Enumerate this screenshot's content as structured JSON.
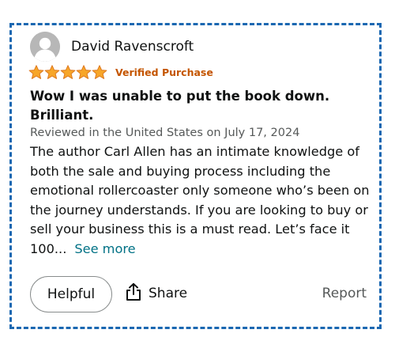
{
  "reviewer": {
    "name": "David Ravenscroft",
    "avatar_icon": "user-silhouette-icon"
  },
  "rating": {
    "stars": 5,
    "max_stars": 5,
    "star_color": "#f7a629",
    "verified_label": "Verified Purchase"
  },
  "review": {
    "title": "Wow I was unable to put the book down. Brilliant.",
    "date_line": "Reviewed in the United States on July 17, 2024",
    "body": "The author Carl Allen has an intimate knowledge of both the sale and buying process including the emotional rollercoaster only someone who’s been on the journey understands. If you are looking to buy or sell your business this is a must read. Let’s face it 100...",
    "see_more_label": "See more"
  },
  "actions": {
    "helpful_label": "Helpful",
    "share_label": "Share",
    "share_icon": "share-icon",
    "report_label": "Report"
  },
  "colors": {
    "frame_border": "#1a67b1",
    "verified": "#c45500",
    "link": "#007185",
    "muted_text": "#565959"
  }
}
